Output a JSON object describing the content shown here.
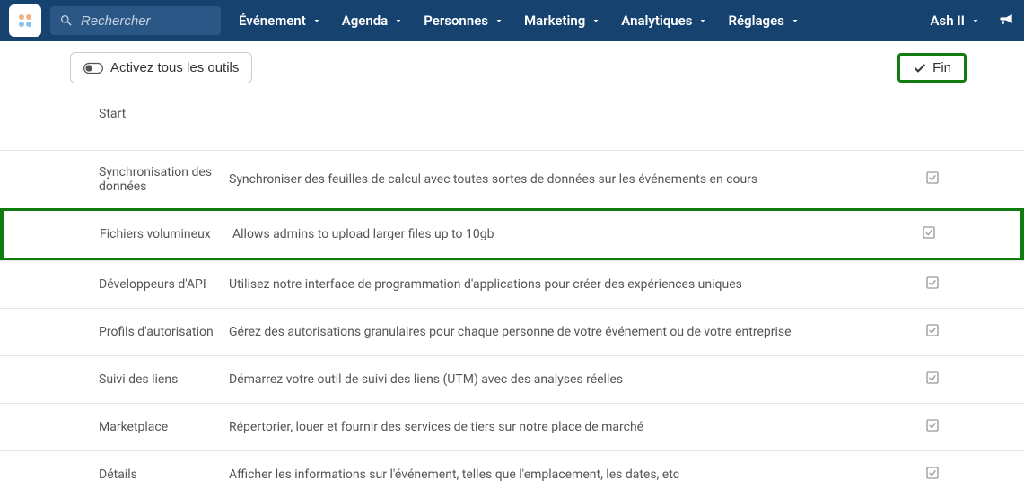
{
  "search": {
    "placeholder": "Rechercher"
  },
  "nav": {
    "items": [
      {
        "label": "Événement"
      },
      {
        "label": "Agenda"
      },
      {
        "label": "Personnes"
      },
      {
        "label": "Marketing"
      },
      {
        "label": "Analytiques"
      },
      {
        "label": "Réglages"
      }
    ]
  },
  "user": {
    "name": "Ash II"
  },
  "toolbar": {
    "activate_label": "Activez tous les outils",
    "fin_label": "Fin"
  },
  "start_label": "Start",
  "rows": [
    {
      "title": "Synchronisation des données",
      "desc": "Synchroniser des feuilles de calcul avec toutes sortes de données sur les événements en cours",
      "highlight": false
    },
    {
      "title": "Fichiers volumineux",
      "desc": "Allows admins to upload larger files up to 10gb",
      "highlight": true
    },
    {
      "title": "Développeurs d'API",
      "desc": "Utilisez notre interface de programmation d'applications pour créer des expériences uniques",
      "highlight": false
    },
    {
      "title": "Profils d'autorisation",
      "desc": "Gérez des autorisations granulaires pour chaque personne de votre événement ou de votre entreprise",
      "highlight": false
    },
    {
      "title": "Suivi des liens",
      "desc": "Démarrez votre outil de suivi des liens (UTM) avec des analyses réelles",
      "highlight": false
    },
    {
      "title": "Marketplace",
      "desc": "Répertorier, louer et fournir des services de tiers sur notre place de marché",
      "highlight": false
    },
    {
      "title": "Détails",
      "desc": "Afficher les informations sur l'événement, telles que l'emplacement, les dates, etc",
      "highlight": false
    }
  ]
}
